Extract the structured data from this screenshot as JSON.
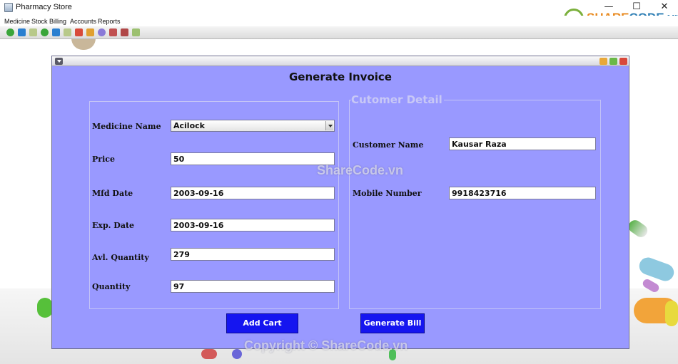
{
  "window": {
    "title": "Pharmacy Store",
    "controls": {
      "minimize": "—",
      "maximize": "☐",
      "close": "✕"
    }
  },
  "menubar": {
    "items": [
      "Medicine",
      "Stock",
      "Billing",
      "Accounts",
      "Reports"
    ]
  },
  "toolbar": {
    "icons": [
      "add-icon",
      "search-icon",
      "table-icon",
      "add-icon",
      "search-icon",
      "table-icon",
      "chart-icon",
      "person-icon",
      "globe-icon",
      "clipboard-icon",
      "clipboard-icon",
      "table-icon"
    ]
  },
  "logo": {
    "part1": "SHARE",
    "part2": "CODE",
    "part3": ".vn"
  },
  "invoice": {
    "title": "Generate Invoice",
    "medicine_name_label": "Medicine Name",
    "medicine_name_value": "Acilock",
    "price_label": "Price",
    "price_value": "50",
    "mfd_label": "Mfd Date",
    "mfd_value": "2003-09-16",
    "exp_label": "Exp. Date",
    "exp_value": "2003-09-16",
    "avl_qty_label": "Avl. Quantity",
    "avl_qty_value": "279",
    "qty_label": "Quantity",
    "qty_value": "97",
    "customer_legend": "Cutomer Detail",
    "customer_name_label": "Customer Name",
    "customer_name_value": "Kausar Raza",
    "mobile_label": "Mobile Number",
    "mobile_value": "9918423716",
    "add_cart_label": "Add Cart",
    "generate_bill_label": "Generate Bill"
  },
  "watermarks": {
    "center": "ShareCode.vn",
    "bottom": "Copyright © ShareCode.vn"
  },
  "colors": {
    "frame_bg": "#9999ff",
    "button_bg": "#1515f0",
    "legend": "#c8c8f6"
  }
}
